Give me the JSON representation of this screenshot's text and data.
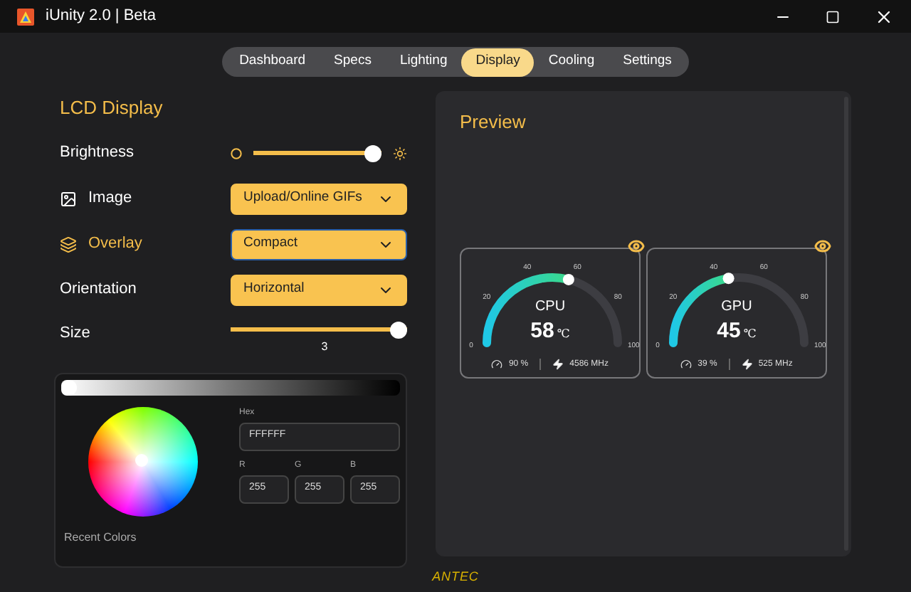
{
  "window": {
    "title": "iUnity 2.0 | Beta"
  },
  "tabs": [
    {
      "label": "Dashboard",
      "selected": false
    },
    {
      "label": "Specs",
      "selected": false
    },
    {
      "label": "Lighting",
      "selected": false
    },
    {
      "label": "Display",
      "selected": true
    },
    {
      "label": "Cooling",
      "selected": false
    },
    {
      "label": "Settings",
      "selected": false
    }
  ],
  "lcd": {
    "title": "LCD Display",
    "rows": [
      {
        "kind": "slider",
        "label": "Brightness",
        "level": 1.0
      },
      {
        "kind": "select",
        "label": "Image",
        "active": false,
        "value": "Upload/Online GIFs"
      },
      {
        "kind": "select",
        "label": "Overlay",
        "active": true,
        "value": "Compact"
      },
      {
        "kind": "select",
        "label": "Orientation",
        "active": false,
        "value": "Horizontal"
      },
      {
        "kind": "slider",
        "label": "Size",
        "level": 1.0,
        "reading": "3"
      }
    ]
  },
  "color_picker": {
    "lightness_slider": {
      "level": 0
    },
    "hex_label": "Hex",
    "hex": "FFFFFF",
    "channels": [
      {
        "label": "R",
        "value": "255"
      },
      {
        "label": "G",
        "value": "255"
      },
      {
        "label": "B",
        "value": "255"
      }
    ],
    "recent_label": "Recent Colors"
  },
  "preview": {
    "title": "Preview",
    "gauges": [
      {
        "name": "CPU",
        "reading": "58",
        "unit": "℃",
        "ticks": [
          "0",
          "20",
          "40",
          "60",
          "80",
          "100"
        ],
        "load": "90 %",
        "clock": "4586 MHz"
      },
      {
        "name": "GPU",
        "reading": "45",
        "unit": "℃",
        "ticks": [
          "0",
          "20",
          "40",
          "60",
          "80",
          "100"
        ],
        "load": "39 %",
        "clock": "525 MHz"
      }
    ]
  },
  "footer": {
    "logo": "ANTEC"
  }
}
